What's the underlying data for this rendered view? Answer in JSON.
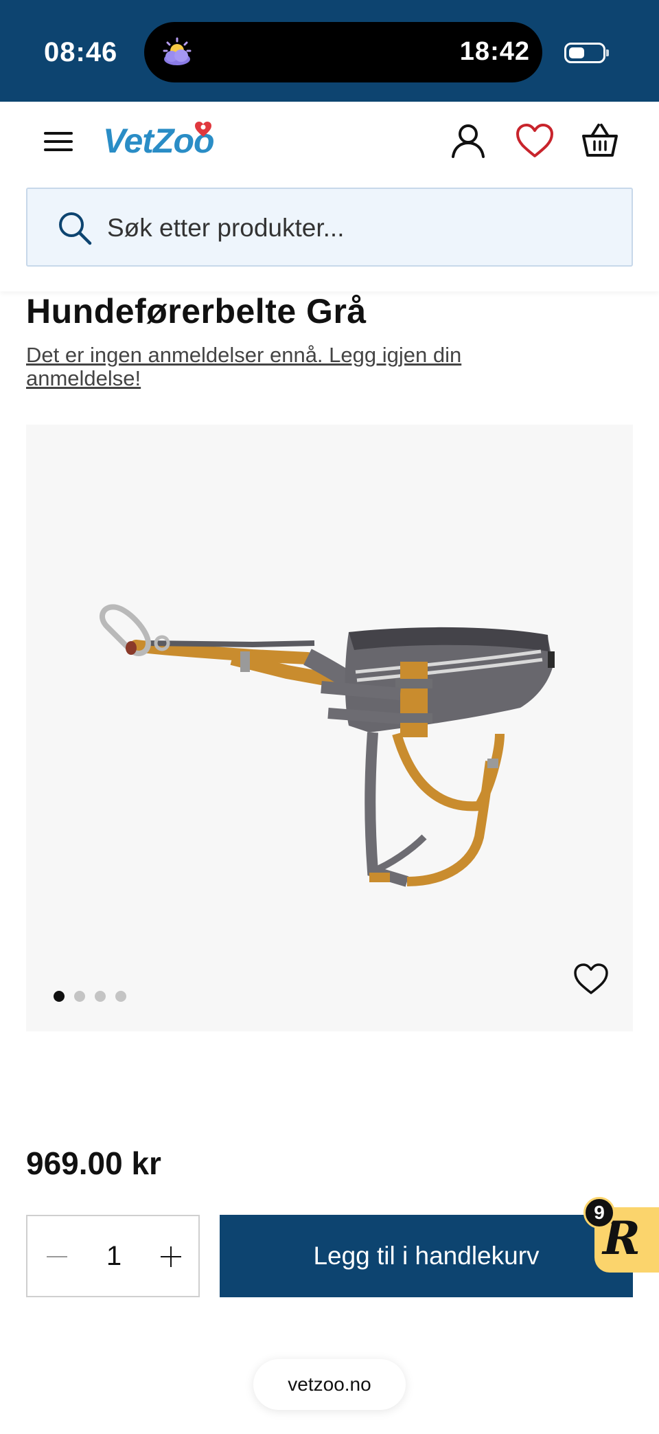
{
  "status_bar": {
    "time": "08:46",
    "island_time": "18:42",
    "island_icon": "weather-sunrise-icon",
    "battery_icon": "battery-icon"
  },
  "header": {
    "logo_text": "VetZoo",
    "icons": [
      "menu-icon",
      "user-icon",
      "heart-icon",
      "basket-icon"
    ],
    "search_placeholder": "Søk etter produkter..."
  },
  "product": {
    "title": "Hundeførerbelte Grå",
    "review_text": "Det er ingen anmeldelser ennå. Legg igjen din anmeldelse!",
    "image_subject": "dog handler belt grey",
    "gallery_dots": 4,
    "active_dot": 1,
    "price": "969.00 kr"
  },
  "purchase": {
    "quantity": "1",
    "add_to_cart_label": "Legg til i handlekurv"
  },
  "rewards": {
    "letter": "R",
    "count": "9"
  },
  "browser": {
    "url": "vetzoo.no"
  },
  "colors": {
    "primary": "#0d4470",
    "logo": "#2a8dc6",
    "wishlist": "#c8242c",
    "search_bg": "#eef5fc",
    "rewards": "#fbd46c"
  }
}
